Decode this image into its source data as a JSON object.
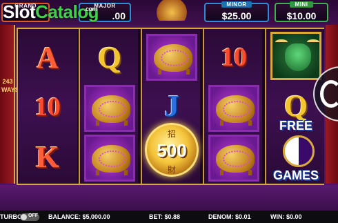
{
  "watermark": {
    "brand_part1": "Slot",
    "brand_part2": "Catalog",
    "suffix": ".com"
  },
  "jackpots": {
    "grand": {
      "label": "GRAND",
      "value": ""
    },
    "major": {
      "label": "MAJOR",
      "value": ".00"
    },
    "minor": {
      "label": "MINOR",
      "value": "$25.00"
    },
    "mini": {
      "label": "MINI",
      "value": "$10.00"
    }
  },
  "ways": {
    "line1": "243",
    "line2": "WAYS"
  },
  "reels": [
    [
      "A",
      "10",
      "K"
    ],
    [
      "Q",
      "pig",
      "pig"
    ],
    [
      "pig",
      "J",
      "coin"
    ],
    [
      "10",
      "pig",
      "pig"
    ],
    [
      "ox",
      "Q",
      "free"
    ]
  ],
  "coin": {
    "value": "500",
    "glyph_top": "招",
    "glyph_bottom": "財"
  },
  "free_games": {
    "line1": "FREE",
    "line2": "GAMES"
  },
  "bottom_bar": {
    "turbo_label": "TURBO",
    "turbo_state": "OFF",
    "balance": "BALANCE: $5,000.00",
    "bet": "BET: $0.88",
    "denom": "DENOM: $0.01",
    "win": "WIN: $0.00"
  },
  "colors": {
    "frame_gold": "#d9a93a",
    "bg_purple": "#4a1160",
    "pig_tile": "#8a2bb0"
  }
}
